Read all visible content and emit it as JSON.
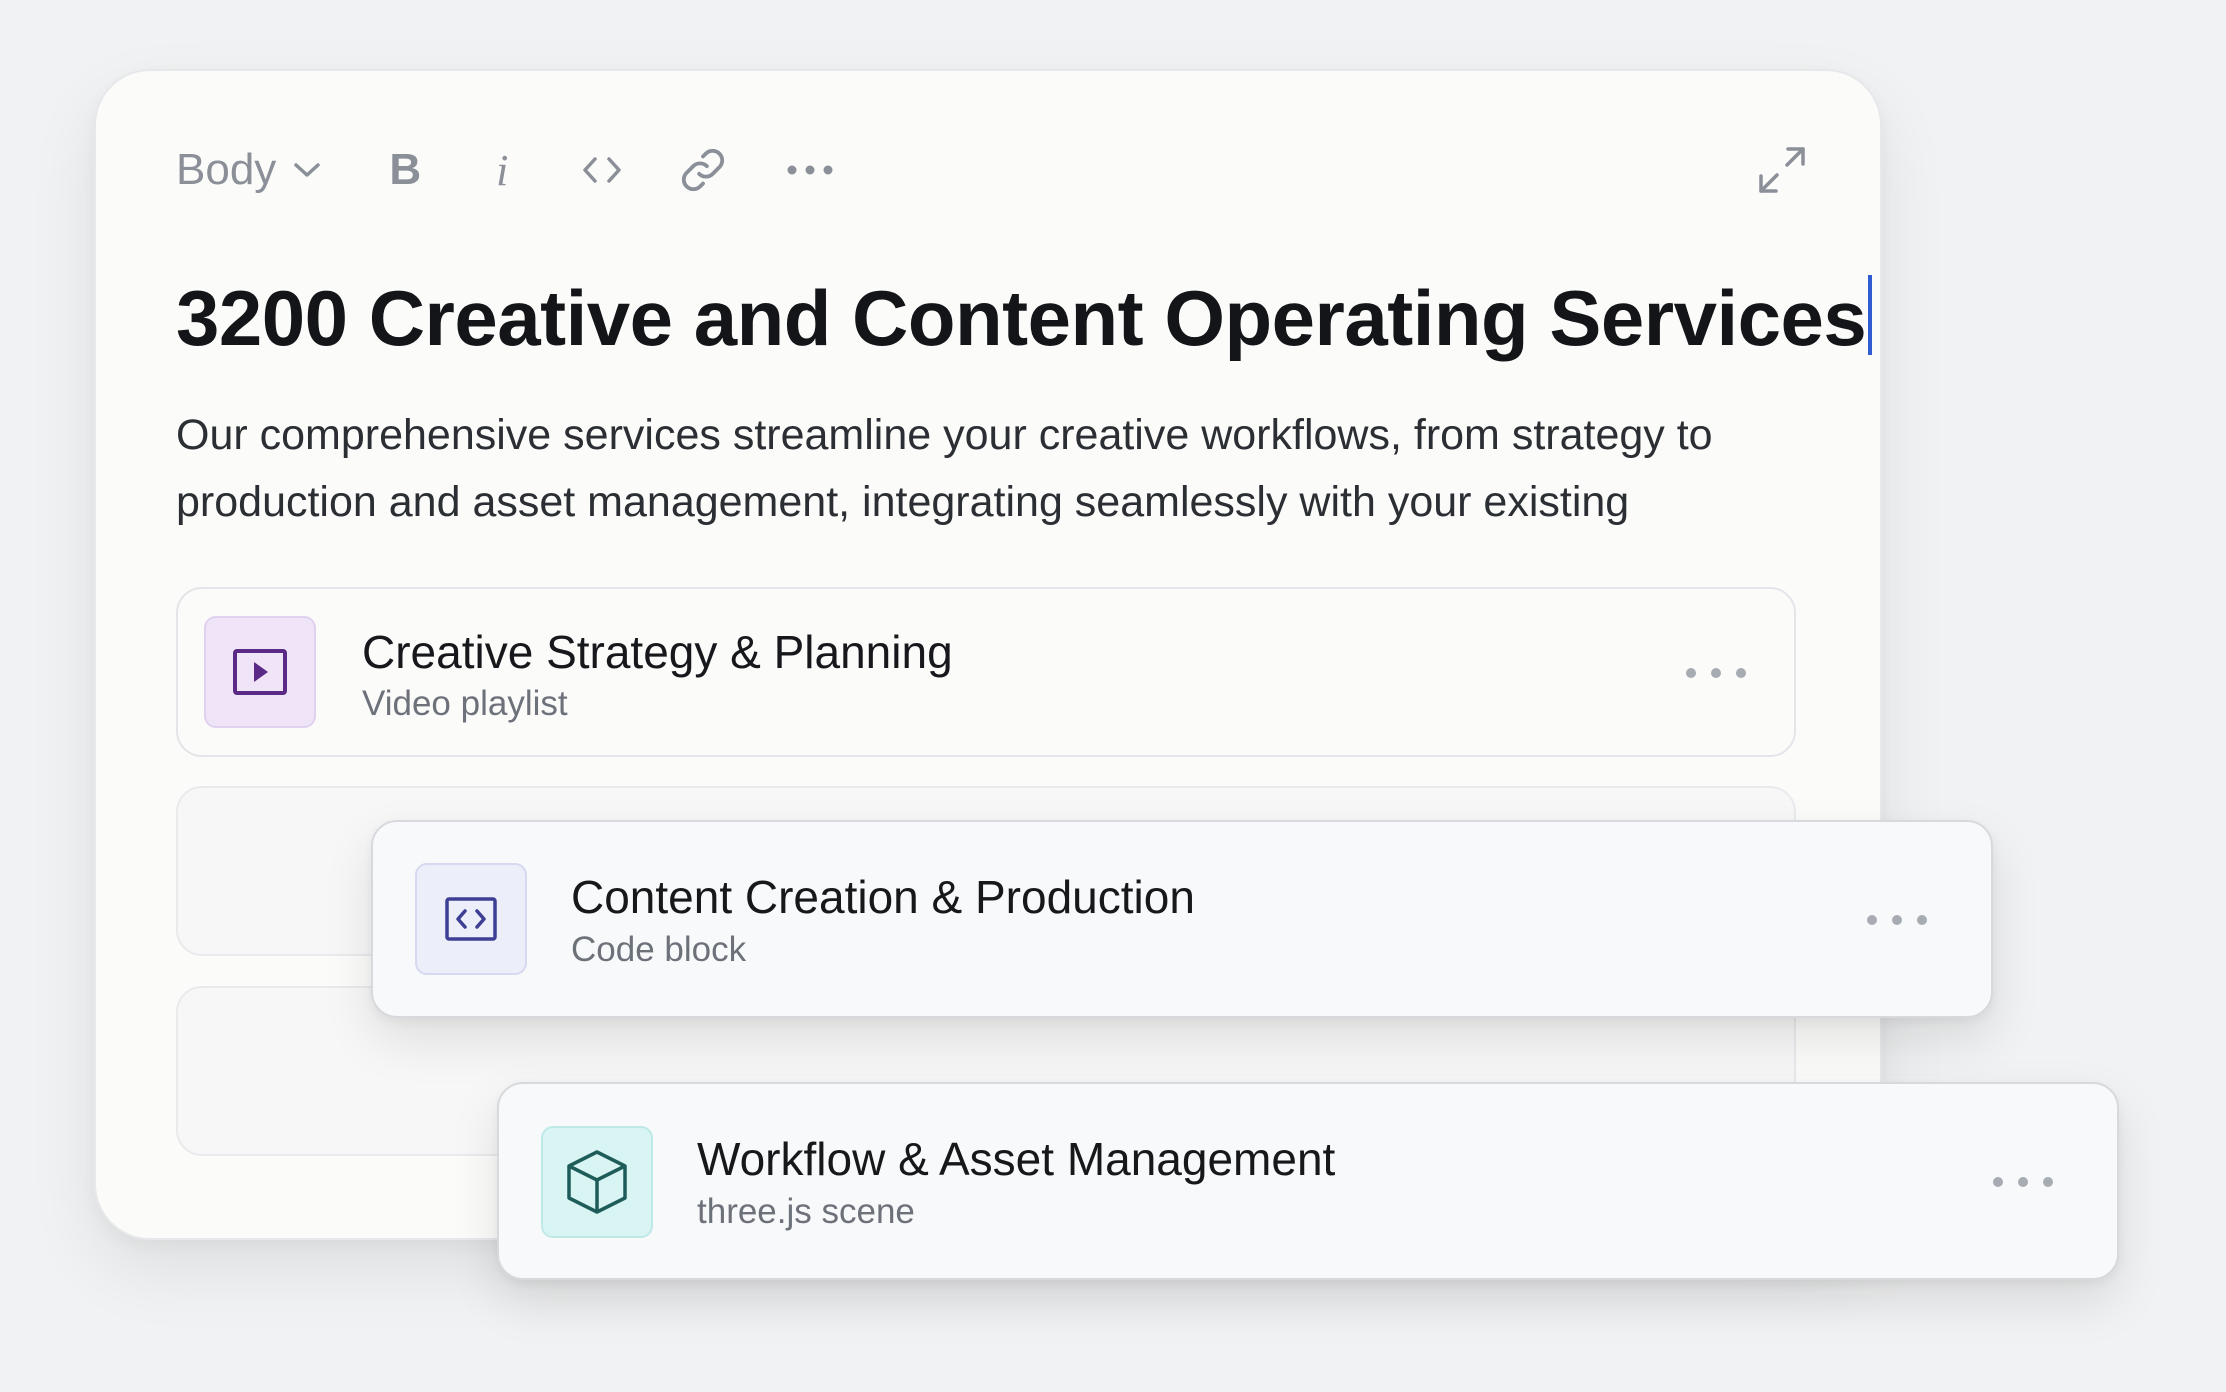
{
  "toolbar": {
    "style_select_value": "Body",
    "bold_label": "B",
    "italic_label": "i",
    "icons": [
      "chevron-down-icon",
      "code-icon",
      "link-icon",
      "more-icon",
      "expand-icon"
    ]
  },
  "document": {
    "title": "3200 Creative and Content Operating Services",
    "description": "Our comprehensive services streamline your creative workflows, from strategy to production and asset management, integrating seamlessly with your existing"
  },
  "blocks": [
    {
      "title": "Creative Strategy & Planning",
      "subtitle": "Video playlist",
      "icon": "video-playlist-icon",
      "icon_color": "#5b2a86",
      "icon_bg": "#efe4f8"
    },
    {
      "title": "Content Creation & Production",
      "subtitle": "Code block",
      "icon": "code-block-icon",
      "icon_color": "#3d3f95",
      "icon_bg": "#eceef9"
    },
    {
      "title": "Workflow & Asset Management",
      "subtitle": "three.js scene",
      "icon": "cube-icon",
      "icon_color": "#1e5c5a",
      "icon_bg": "#d8f4f3"
    }
  ],
  "colors": {
    "background": "#f1f2f3",
    "card": "#fbfbfa",
    "text_primary": "#141518",
    "text_muted": "#8a8f98",
    "caret": "#2f5bd3"
  }
}
